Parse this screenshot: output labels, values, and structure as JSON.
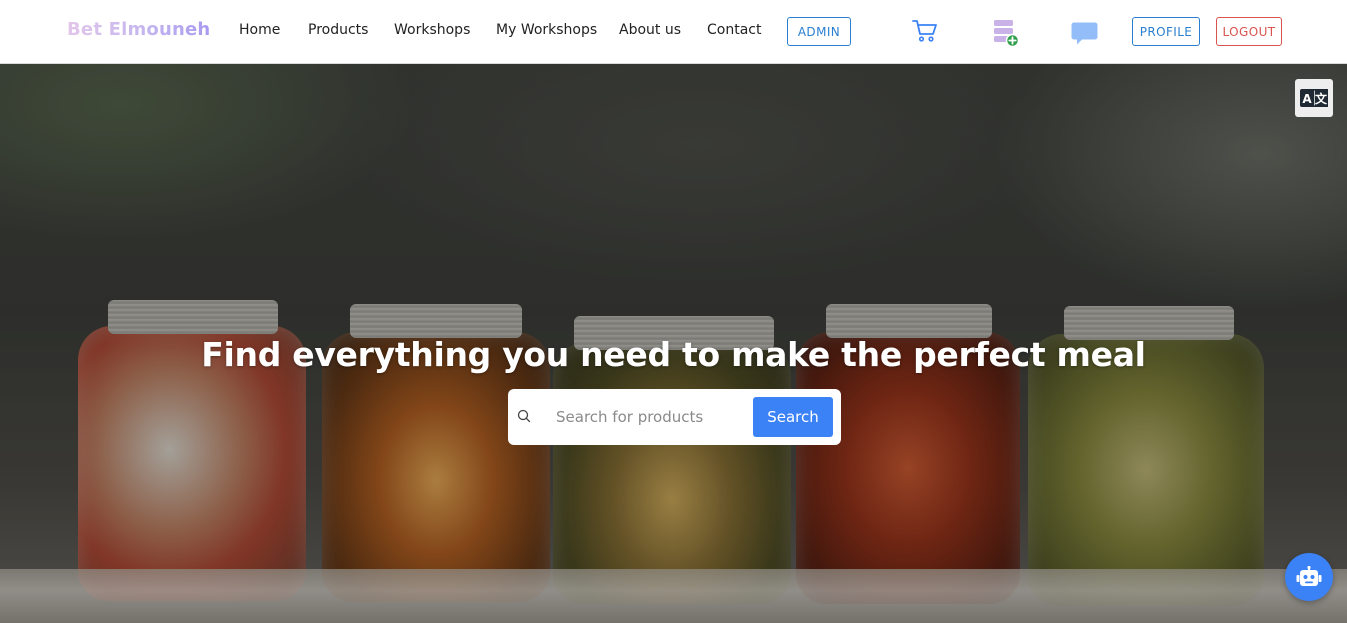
{
  "brand": {
    "name": "Bet Elmouneh"
  },
  "nav": {
    "links": [
      {
        "label": "Home"
      },
      {
        "label": "Products"
      },
      {
        "label": "Workshops"
      },
      {
        "label": "My Workshops"
      },
      {
        "label": "About us"
      },
      {
        "label": "Contact"
      }
    ],
    "admin_label": "ADMIN",
    "profile_label": "PROFILE",
    "logout_label": "LOGOUT",
    "icons": [
      "cart-icon",
      "add-database-icon",
      "chat-icon"
    ]
  },
  "hero": {
    "title": "Find everything you need to make the perfect meal",
    "search": {
      "placeholder": "Search for products",
      "value": "",
      "button_label": "Search"
    },
    "translate_icon": "translate-icon",
    "chatbot_icon": "robot-icon"
  },
  "colors": {
    "accent_blue": "#3b82f6",
    "outline_blue": "#2a7fd0",
    "logout_red": "#d9534f",
    "chat_icon_blue": "#93bdf9",
    "db_icon_purple": "#c9b2e8",
    "plus_badge_green": "#2e9e4a"
  }
}
